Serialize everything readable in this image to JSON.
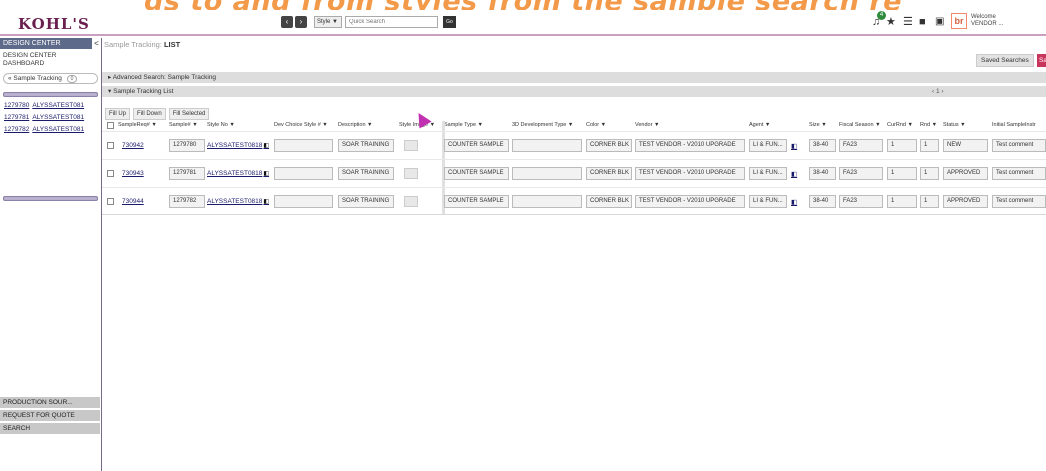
{
  "banner": "ds to and from styles from the sample search re",
  "header": {
    "logo": "KOHL'S",
    "style_select": "Style ▼",
    "quick_search_placeholder": "Quick Search",
    "go": "Go",
    "notification_count": "4",
    "brand_logo": "br",
    "welcome_line1": "Welcome",
    "welcome_line2": "VENDOR ..."
  },
  "sidebar": {
    "title": "DESIGN CENTER",
    "collapse": "<",
    "dashboard_line1": "DESIGN CENTER",
    "dashboard_line2": "DASHBOARD",
    "sample_tracking": "« Sample Tracking",
    "sample_tracking_count": "0",
    "recent": [
      {
        "id": "1279780",
        "style": "ALYSSATEST081"
      },
      {
        "id": "1279781",
        "style": "ALYSSATEST081"
      },
      {
        "id": "1279782",
        "style": "ALYSSATEST081"
      }
    ],
    "bottom": [
      "PRODUCTION SOUR...",
      "REQUEST FOR QUOTE",
      "SEARCH"
    ]
  },
  "main": {
    "breadcrumb_section": "Sample Tracking:",
    "breadcrumb_page": "LIST",
    "saved_searches": "Saved Searches",
    "save": "Sa",
    "advanced_search": "▸  Advanced Search: Sample Tracking",
    "list_title": "▾  Sample Tracking List",
    "pager": "‹ 1  ›",
    "fill_buttons": [
      "Fill Up",
      "Fill Down",
      "Fill Selected"
    ],
    "columns": [
      "SampleReq# ▼",
      "Sample# ▼",
      "Style No ▼",
      "Dev Choice Style # ▼",
      "Description ▼",
      "Style Image ▼",
      "Sample Type ▼",
      "3D Development Type ▼",
      "Color ▼",
      "Vendor ▼",
      "Agent ▼",
      "Size ▼",
      "Fiscal Season ▼",
      "CurRnd ▼",
      "Rnd ▼",
      "Status ▼",
      "Initial SampleInstr"
    ],
    "rows": [
      {
        "req": "730942",
        "sample": "1279780",
        "style": "ALYSSATEST0818",
        "description": "SOAR TRAINING",
        "type": "COUNTER SAMPLE",
        "color": "CORNER BLK",
        "vendor": "TEST VENDOR - V2010 UPGRADE",
        "agent": "LI & FUN...",
        "size": "38-40",
        "season": "FA23",
        "currnd": "1",
        "rnd": "1",
        "status": "NEW",
        "instr": "Test comment"
      },
      {
        "req": "730943",
        "sample": "1279781",
        "style": "ALYSSATEST0818",
        "description": "SOAR TRAINING",
        "type": "COUNTER SAMPLE",
        "color": "CORNER BLK",
        "vendor": "TEST VENDOR - V2010 UPGRADE",
        "agent": "LI & FUN...",
        "size": "38-40",
        "season": "FA23",
        "currnd": "1",
        "rnd": "1",
        "status": "APPROVED",
        "instr": "Test comment"
      },
      {
        "req": "730944",
        "sample": "1279782",
        "style": "ALYSSATEST0818",
        "description": "SOAR TRAINING",
        "type": "COUNTER SAMPLE",
        "color": "CORNER BLK",
        "vendor": "TEST VENDOR - V2010 UPGRADE",
        "agent": "LI & FUN...",
        "size": "38-40",
        "season": "FA23",
        "currnd": "1",
        "rnd": "1",
        "status": "APPROVED",
        "instr": "Test comment"
      }
    ]
  }
}
